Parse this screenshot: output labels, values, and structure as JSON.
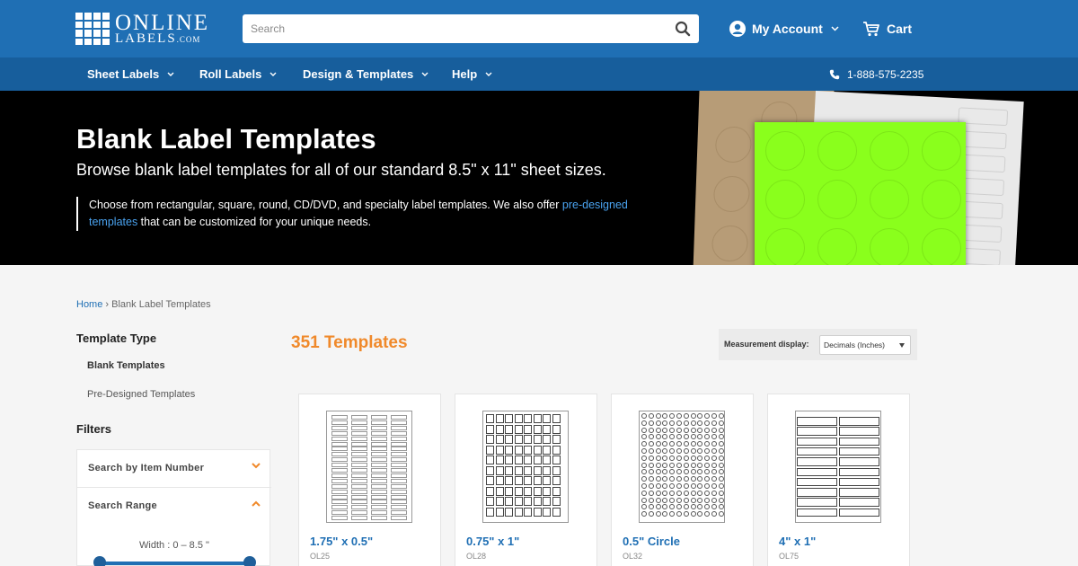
{
  "header": {
    "logo_main": "ONLINE",
    "logo_sub": "LABELS",
    "logo_suffix": ".COM",
    "search_placeholder": "Search",
    "account_label": "My Account",
    "cart_label": "Cart",
    "brand_color": "#1f6fb4"
  },
  "nav": {
    "items": [
      {
        "label": "Sheet Labels"
      },
      {
        "label": "Roll Labels"
      },
      {
        "label": "Design & Templates"
      },
      {
        "label": "Help"
      }
    ],
    "phone": "1-888-575-2235"
  },
  "hero": {
    "title": "Blank Label Templates",
    "subtitle": "Browse blank label templates for all of our standard 8.5\" x 11\" sheet sizes.",
    "desc_before": "Choose from rectangular, square, round, CD/DVD, and specialty label templates. We also offer ",
    "desc_link": "pre-designed templates",
    "desc_after": " that can be customized for your unique needs."
  },
  "breadcrumb": {
    "home": "Home",
    "separator": "›",
    "current": "Blank Label Templates"
  },
  "sidebar": {
    "template_type_heading": "Template Type",
    "template_types": [
      {
        "label": "Blank Templates",
        "active": true
      },
      {
        "label": "Pre-Designed Templates",
        "active": false
      }
    ],
    "filters_heading": "Filters",
    "filters": [
      {
        "label": "Search by Item Number",
        "expanded": false
      },
      {
        "label": "Search Range",
        "expanded": true
      }
    ],
    "width_label": "Width : 0 – 8.5 \"",
    "accent_color": "#f0892a"
  },
  "results": {
    "count_label": "351 Templates",
    "measurement_label": "Measurement display:",
    "measurement_value": "Decimals (Inches)"
  },
  "cards": [
    {
      "title": "1.75\" x 0.5\"",
      "sku": "OL25"
    },
    {
      "title": "0.75\" x 1\"",
      "sku": "OL28"
    },
    {
      "title": "0.5\" Circle",
      "sku": "OL32"
    },
    {
      "title": "4\" x 1\"",
      "sku": "OL75"
    }
  ]
}
